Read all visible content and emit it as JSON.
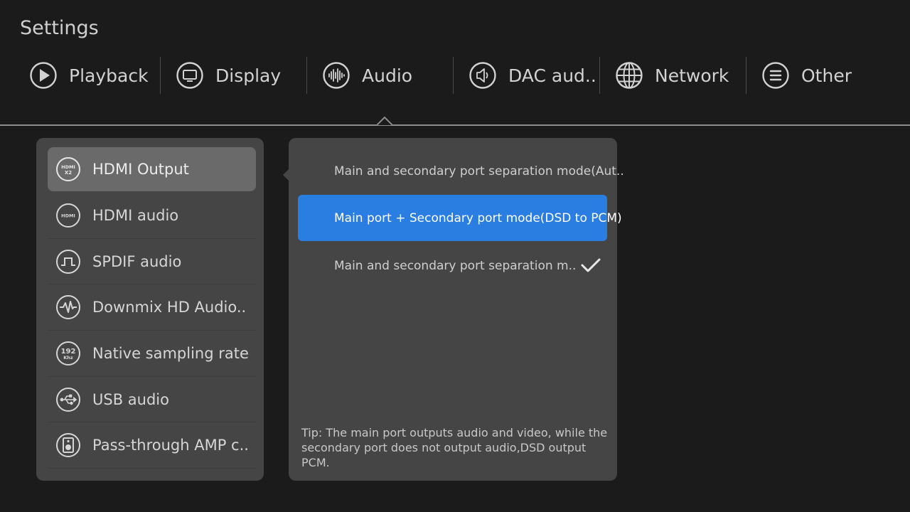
{
  "page": {
    "title": "Settings"
  },
  "tabs": [
    {
      "label": "Playback",
      "icon": "play-circle-icon"
    },
    {
      "label": "Display",
      "icon": "monitor-icon"
    },
    {
      "label": "Audio",
      "icon": "audio-wave-icon",
      "active": true
    },
    {
      "label": "DAC aud..",
      "icon": "speaker-icon"
    },
    {
      "label": "Network",
      "icon": "globe-icon"
    },
    {
      "label": "Other",
      "icon": "menu-lines-icon"
    }
  ],
  "menu": {
    "items": [
      {
        "label": "HDMI Output",
        "icon": "hdmi-x2-icon",
        "icon_text": [
          "HDMI",
          "X2"
        ],
        "selected": true
      },
      {
        "label": "HDMI audio",
        "icon": "hdmi-icon",
        "icon_text": [
          "HDMI"
        ]
      },
      {
        "label": "SPDIF audio",
        "icon": "square-wave-icon"
      },
      {
        "label": "Downmix HD Audio..",
        "icon": "waveform-icon"
      },
      {
        "label": "Native sampling rate",
        "icon": "sampling-rate-icon",
        "icon_text": [
          "192",
          "Khz"
        ]
      },
      {
        "label": "USB audio",
        "icon": "usb-icon"
      },
      {
        "label": "Pass-through AMP c..",
        "icon": "amp-speaker-icon"
      }
    ]
  },
  "options": {
    "items": [
      {
        "label": "Main and secondary port separation mode(Aut.."
      },
      {
        "label": "Main port + Secondary port mode(DSD to PCM)",
        "highlighted": true
      },
      {
        "label": "Main and secondary port separation m..",
        "checked": true
      }
    ],
    "tip": "Tip: The main port outputs audio and video, while the secondary port does not output audio,DSD output PCM."
  },
  "colors": {
    "background": "#1b1b1b",
    "panel": "#454545",
    "selected_item": "#6a6a6a",
    "highlight": "#2a7de1"
  }
}
